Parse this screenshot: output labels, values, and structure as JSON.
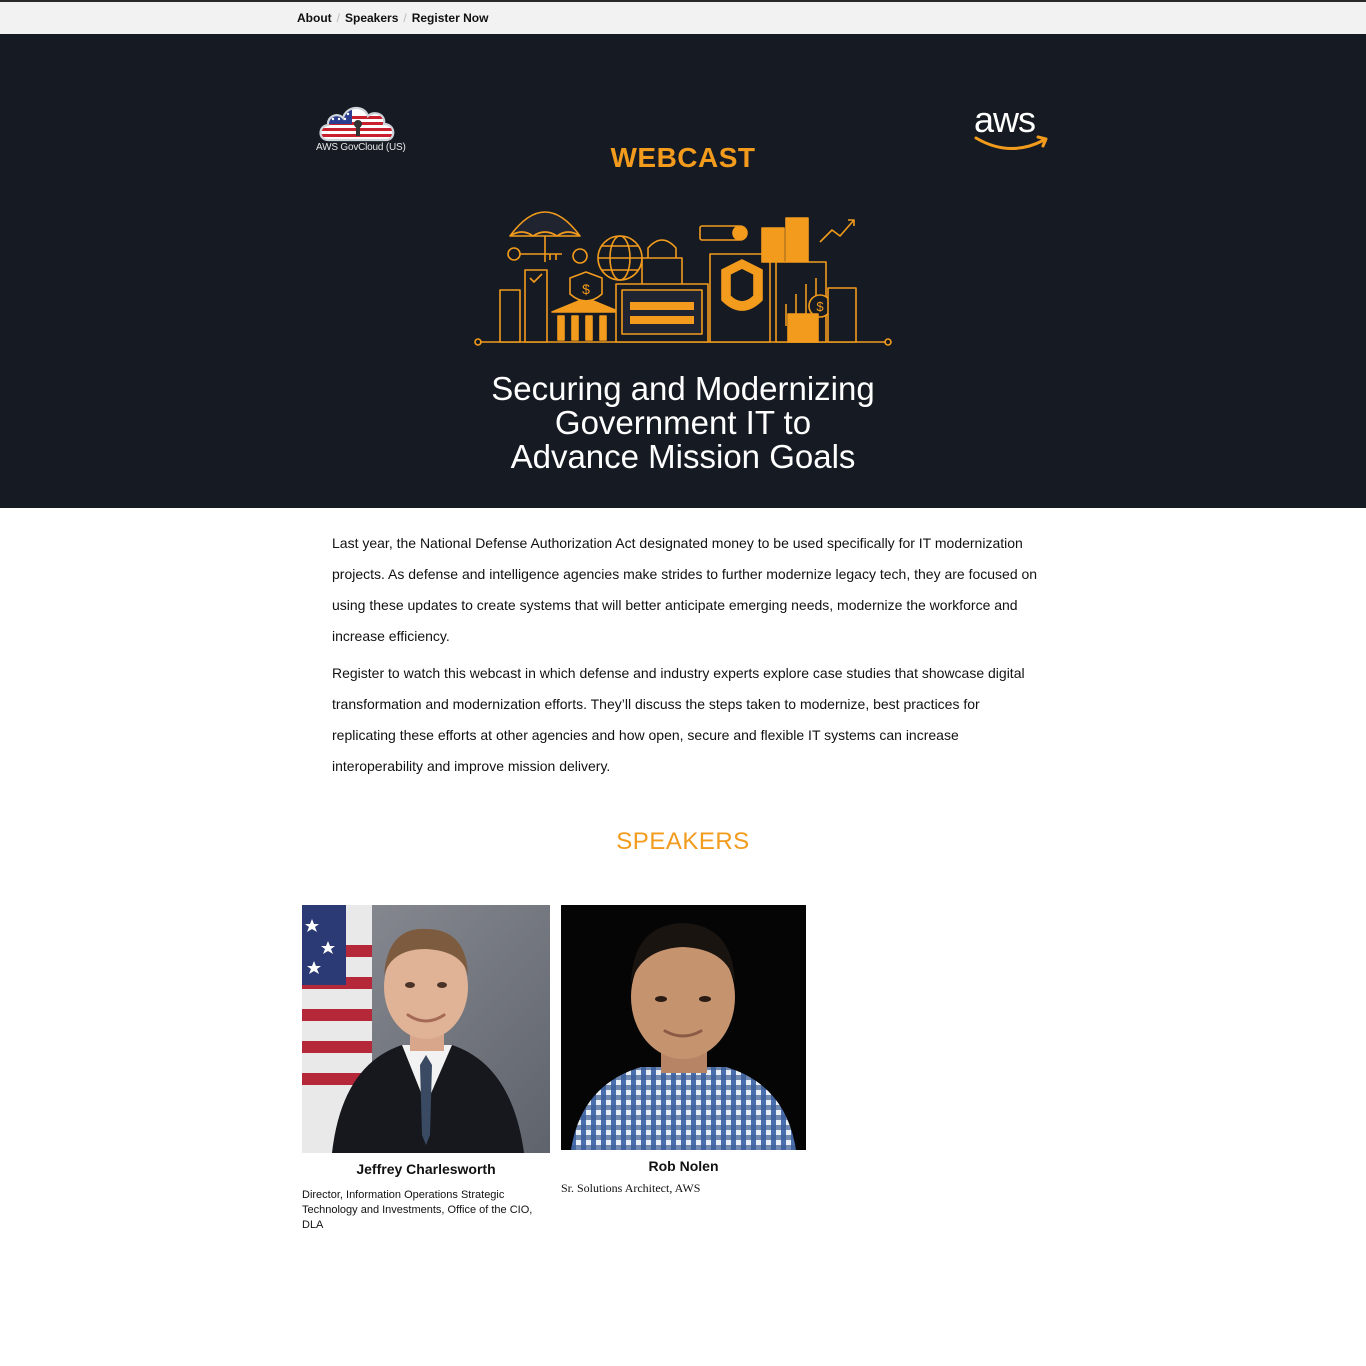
{
  "nav": {
    "items": [
      {
        "label": "About"
      },
      {
        "label": "Speakers"
      },
      {
        "label": "Register Now"
      }
    ],
    "separator": "/"
  },
  "hero": {
    "gov_logo_caption": "AWS GovCloud (US)",
    "aws_logo_text": "aws",
    "eyebrow": "WEBCAST",
    "title_lines": [
      "Securing and Modernizing",
      "Government IT to",
      "Advance Mission Goals"
    ]
  },
  "body": {
    "paragraphs": [
      "Last year, the National Defense Authorization Act designated money to be used specifically for IT modernization projects. As defense and intelligence agencies make strides to further modernize legacy tech, they are focused on using these updates to create systems that will better anticipate emerging needs, modernize the workforce and increase efficiency.",
      "Register to watch this webcast in which defense and industry experts explore case studies that showcase digital transformation and modernization efforts. They’ll discuss the steps taken to modernize, best practices for replicating these efforts at other agencies and how open, secure and flexible IT systems can increase interoperability and improve mission delivery."
    ]
  },
  "speakers": {
    "heading": "SPEAKERS",
    "list": [
      {
        "name": "Jeffrey Charlesworth",
        "role": "Director, Information Operations Strategic Technology and Investments, Office of the CIO, DLA"
      },
      {
        "name": "Rob Nolen",
        "role": "Sr. Solutions Architect, AWS"
      }
    ]
  },
  "colors": {
    "accent": "#f29b1d",
    "hero_bg": "#161a22",
    "nav_bg": "#f2f2f2"
  }
}
